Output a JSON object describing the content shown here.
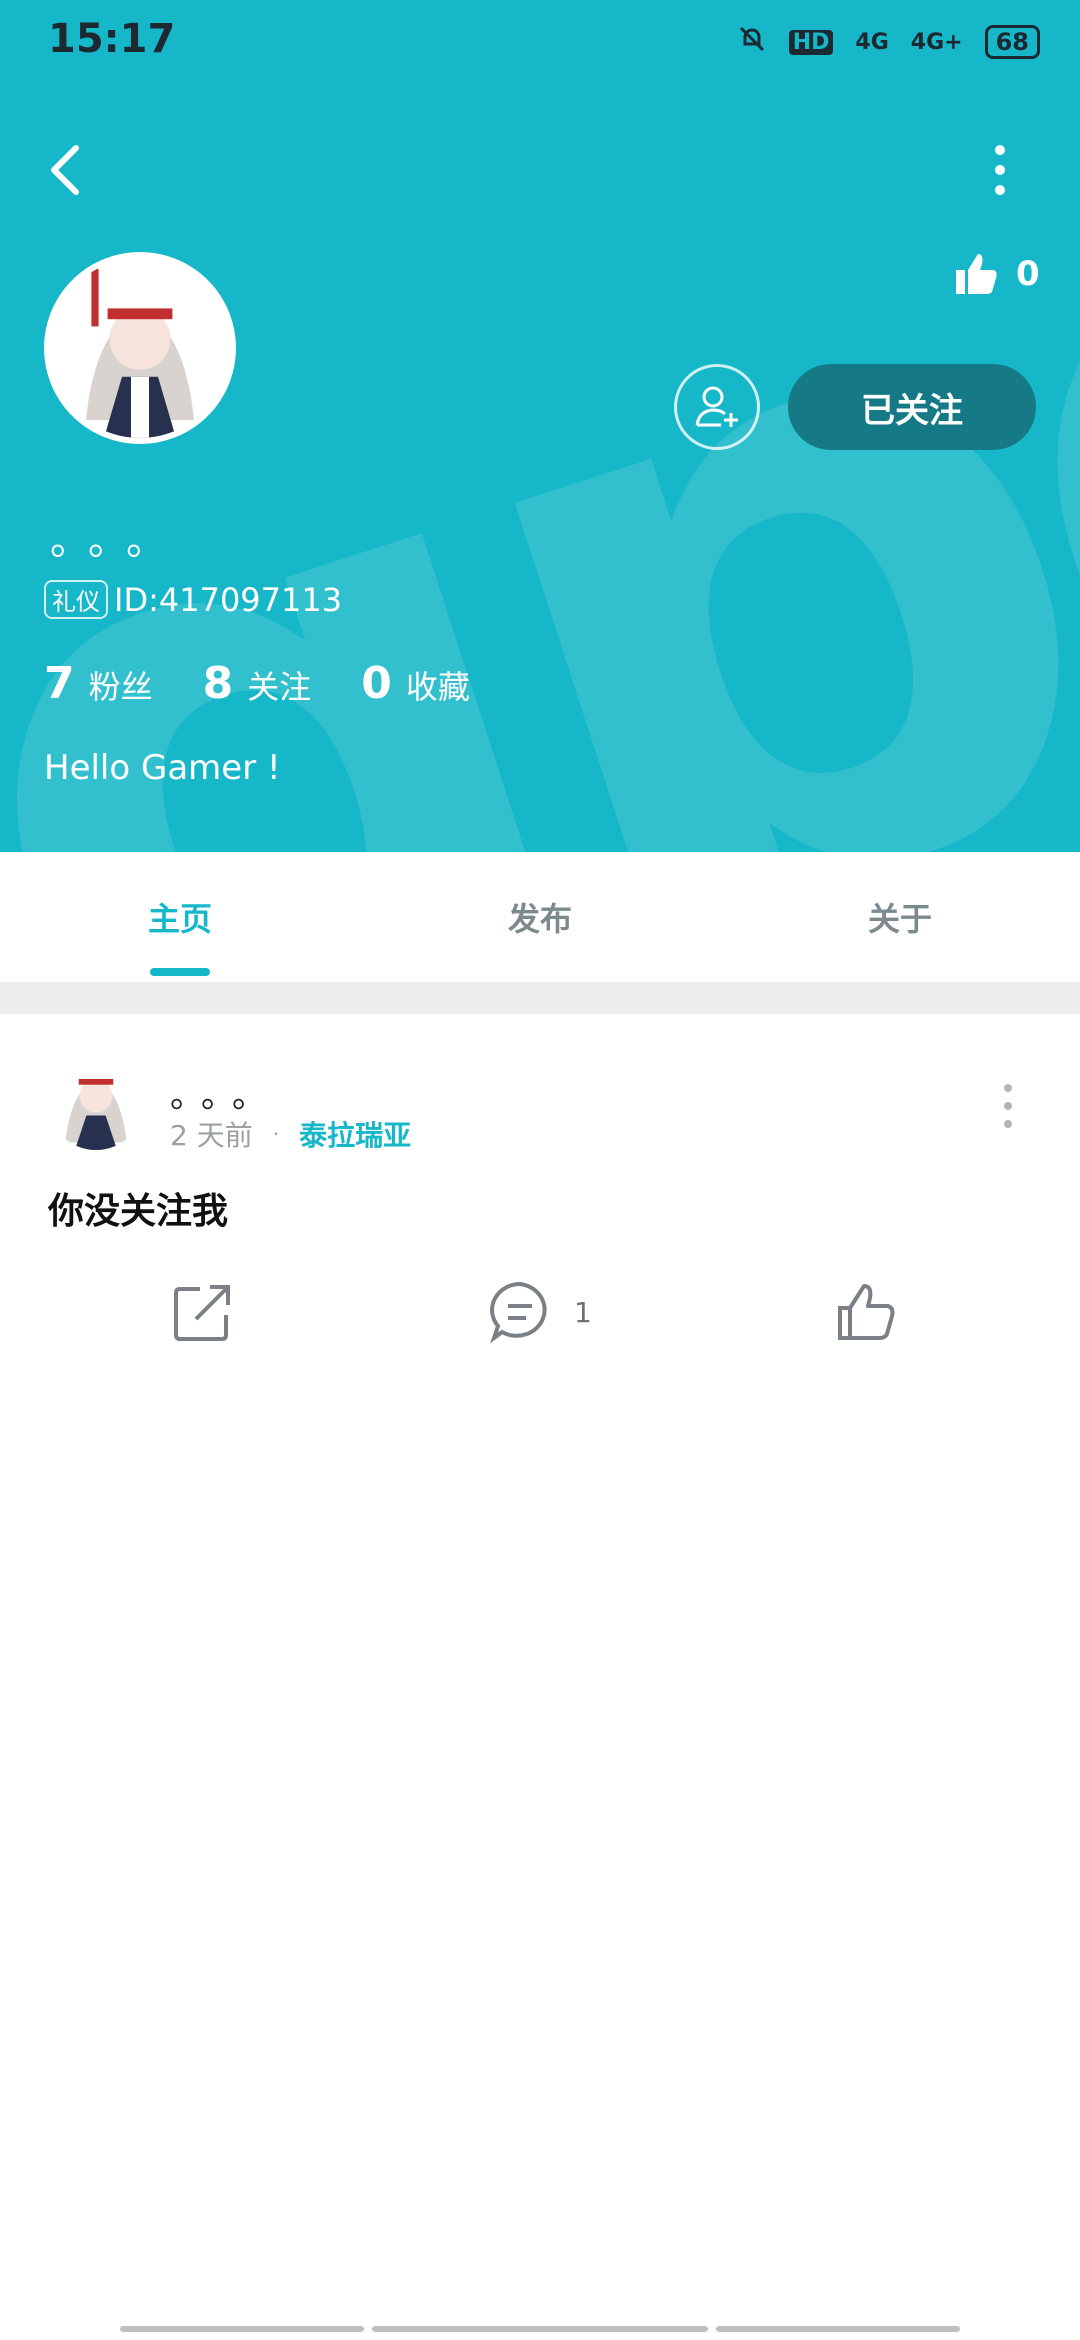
{
  "status_bar": {
    "time": "15:17",
    "hd": "HD",
    "net1": "4G",
    "net2": "4G+",
    "battery": "68"
  },
  "profile": {
    "nickname": "。。。",
    "badge": "礼仪",
    "id_text": "ID:417097113",
    "likes": "0",
    "follow_label": "已关注",
    "stats": [
      {
        "num": "7",
        "label": "粉丝"
      },
      {
        "num": "8",
        "label": "关注"
      },
      {
        "num": "0",
        "label": "收藏"
      }
    ],
    "bio": "Hello Gamer !"
  },
  "tabs": [
    {
      "label": "主页"
    },
    {
      "label": "发布"
    },
    {
      "label": "关于"
    }
  ],
  "post": {
    "author": "。。。",
    "time": "2 天前",
    "separator": "·",
    "tag": "泰拉瑞亚",
    "text": "你没关注我",
    "comment_count": "1"
  },
  "colors": {
    "accent": "#16b7c8",
    "follow_bg": "#157a86"
  },
  "icons": [
    "back-icon",
    "more-icon",
    "thumbs-up-icon",
    "add-friend-icon",
    "share-icon",
    "comment-icon",
    "like-icon"
  ]
}
